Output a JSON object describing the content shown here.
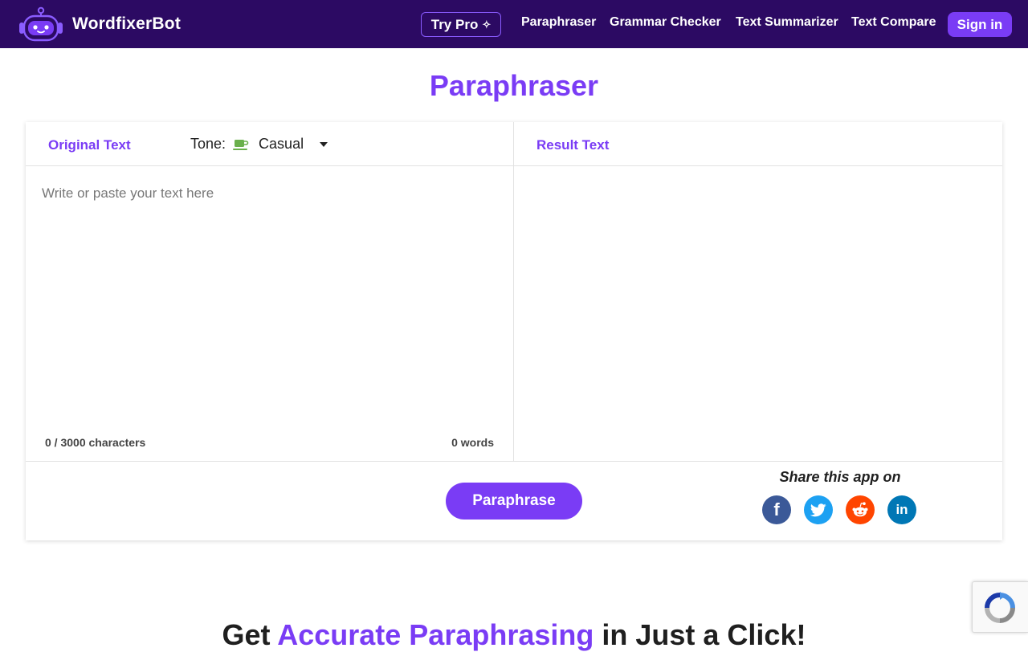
{
  "header": {
    "brand_name": "WordfixerBot",
    "try_pro_label": "Try Pro",
    "nav": [
      "Paraphraser",
      "Grammar Checker",
      "Text Summarizer",
      "Text Compare"
    ],
    "signin_label": "Sign in"
  },
  "page_title": "Paraphraser",
  "tool": {
    "original_tab": "Original Text",
    "tone_label": "Tone:",
    "tone_value": "Casual",
    "input_placeholder": "Write or paste your text here",
    "input_value": "",
    "char_count": "0 / 3000 characters",
    "word_count": "0 words",
    "result_tab": "Result Text",
    "result_value": "",
    "paraphrase_button": "Paraphrase",
    "share_title": "Share this app on",
    "share_icons": [
      {
        "icon": "facebook-icon",
        "glyph": "f",
        "color": "#3b5998"
      },
      {
        "icon": "twitter-icon",
        "glyph": "",
        "color": "#1da1f2"
      },
      {
        "icon": "reddit-icon",
        "glyph": "",
        "color": "#ff4500"
      },
      {
        "icon": "linkedin-icon",
        "glyph": "in",
        "color": "#0077b5"
      }
    ]
  },
  "promo": {
    "title_start": "Get ",
    "title_accent": "Accurate Paraphrasing",
    "title_end": " in Just a Click!"
  },
  "colors": {
    "nav_bg": "#2c0a63",
    "accent": "#7a3cf5",
    "tone_icon": "#6ab04c"
  }
}
